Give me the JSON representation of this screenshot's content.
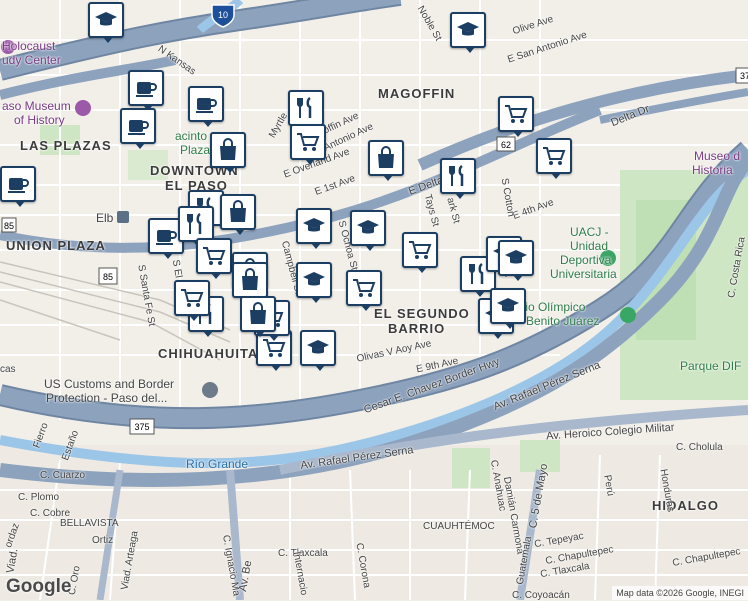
{
  "map": {
    "labels": {
      "magoffin": "MAGOFFIN",
      "las_plazas": "LAS PLAZAS",
      "downtown_1": "DOWNTOWN",
      "downtown_2": "EL PASO",
      "union_plaza": "UNION PLAZA",
      "segundo_1": "EL SEGUNDO",
      "segundo_2": "BARRIO",
      "chihuahuita": "CHIHUAHUITA",
      "hidalgo": "HIDALGO",
      "bellavista": "BELLAVISTA",
      "cuauhtemoc": "CUAUHTÉMOC",
      "parque_dif": "Parque DIF",
      "rio_grande": "Río Grande",
      "holocaust_1": "Holocaust",
      "holocaust_2": "udy Center",
      "museum_1": "aso Museum",
      "museum_2": "of History",
      "jacinto_1": "acinto",
      "jacinto_2": "Plaza",
      "uacj_1": "UACJ -",
      "uacj_2": "Unidad",
      "uacj_3": "Deportiva",
      "uacj_4": "Universitaria",
      "estadio_1": "adio Olímpico",
      "estadio_2": "Benito Juárez",
      "museo_1": "Museo d",
      "museo_2": "Historia",
      "customs_1": "US Customs and Border",
      "customs_2": "Protection - Paso del...",
      "elb": "Elb",
      "streets": {
        "noble": "Noble St",
        "olive": "Olive Ave",
        "san_antonio_e": "E San Antonio Ave",
        "n_kansas": "N Kansas",
        "myrtle": "Myrtle",
        "magoffin_ave": "offin Ave",
        "antonio_ave": "Antonio Ave",
        "overland": "E Overland Ave",
        "first": "E 1st Ave",
        "delta": "E Delta",
        "delta_dr": "Delta Dr",
        "fourth": "E 4th Ave",
        "cotton": "S Cotton",
        "tays": "Tays St",
        "park": "ark St",
        "ochoa": "S Ochoa St",
        "campbell": "Campbell St",
        "el_paso_st": "S El Paso St",
        "santa_fe": "S Santa Fe St",
        "olivas": "Olivas V Aoy Ave",
        "ninth": "E 9th Ave",
        "cesar_chavez": "Cesar E. Chavez Border Hwy",
        "rafael_1": "Av. Rafael Pérez Serna",
        "rafael_2": "Av. Rafael Pérez Serna",
        "heroico": "Av. Heroico Colegio Militar",
        "cholula": "C. Cholula",
        "costa_rica": "C. Costa Rica",
        "tepeyac": "C. Tepeyac",
        "chapultepec1": "C. Chapultepec",
        "chapultepec2": "C. Chapultepec",
        "tlaxcala1": "C. Tlaxcala",
        "tlaxcala2": "C. Tlaxcala",
        "coyoacan": "C. Coyoacán",
        "peru": "Perú",
        "honduras": "Honduras",
        "anahuac": "C. Anahuac",
        "damian": "Damián Carmona",
        "cinco_mayo": "C. 5 de Mayo",
        "guatemala": "Guatemala",
        "corona": "C. Corona",
        "internacional": "Internacio",
        "ignacio": "C. Ignacio Ma",
        "arteaga": "Viad. Arteaga",
        "oro": "C. Oro",
        "plomo": "C. Plomo",
        "cobre": "C. Cobre",
        "ortiz": "Ortiz",
        "fierro": "Fierro",
        "estano": "Estaño",
        "cuarzo": "C. Cuarzo",
        "ordaz": "ordaz",
        "av_be": "Av. Be",
        "viad": "Viad.",
        "cas": "cas"
      },
      "shields": {
        "i10": "10",
        "us85a": "85",
        "us85b": "85",
        "us62": "62",
        "us375": "375",
        "us37": "37"
      }
    },
    "pins": [
      {
        "type": "school"
      },
      {
        "type": "school"
      },
      {
        "type": "coffee"
      },
      {
        "type": "coffee"
      },
      {
        "type": "coffee"
      },
      {
        "type": "coffee"
      },
      {
        "type": "coffee"
      },
      {
        "type": "restaurant"
      },
      {
        "type": "restaurant"
      },
      {
        "type": "restaurant"
      },
      {
        "type": "restaurant"
      },
      {
        "type": "restaurant"
      },
      {
        "type": "restaurant"
      },
      {
        "type": "shopping-cart"
      },
      {
        "type": "shopping-cart"
      },
      {
        "type": "shopping-cart"
      },
      {
        "type": "shopping-cart"
      },
      {
        "type": "shopping-cart"
      },
      {
        "type": "shopping-cart"
      },
      {
        "type": "shopping-cart"
      },
      {
        "type": "shopping-cart"
      },
      {
        "type": "shopping-cart"
      },
      {
        "type": "shopping-bag"
      },
      {
        "type": "shopping-bag"
      },
      {
        "type": "shopping-bag"
      },
      {
        "type": "shopping-bag"
      },
      {
        "type": "shopping-bag"
      },
      {
        "type": "shopping-bag"
      },
      {
        "type": "school"
      },
      {
        "type": "school"
      },
      {
        "type": "school"
      },
      {
        "type": "school"
      },
      {
        "type": "school"
      },
      {
        "type": "school"
      },
      {
        "type": "school"
      },
      {
        "type": "school"
      }
    ]
  },
  "footer": {
    "logo": "Google",
    "attribution": "Map data ©2026 Google, INEGI"
  },
  "colors": {
    "highway": "#8da2bd",
    "highway_edge": "#6f86a3",
    "river": "#9cc6e8",
    "park": "#cfe6c4",
    "pin_border": "#1d3e63",
    "building": "#e6e2da"
  }
}
